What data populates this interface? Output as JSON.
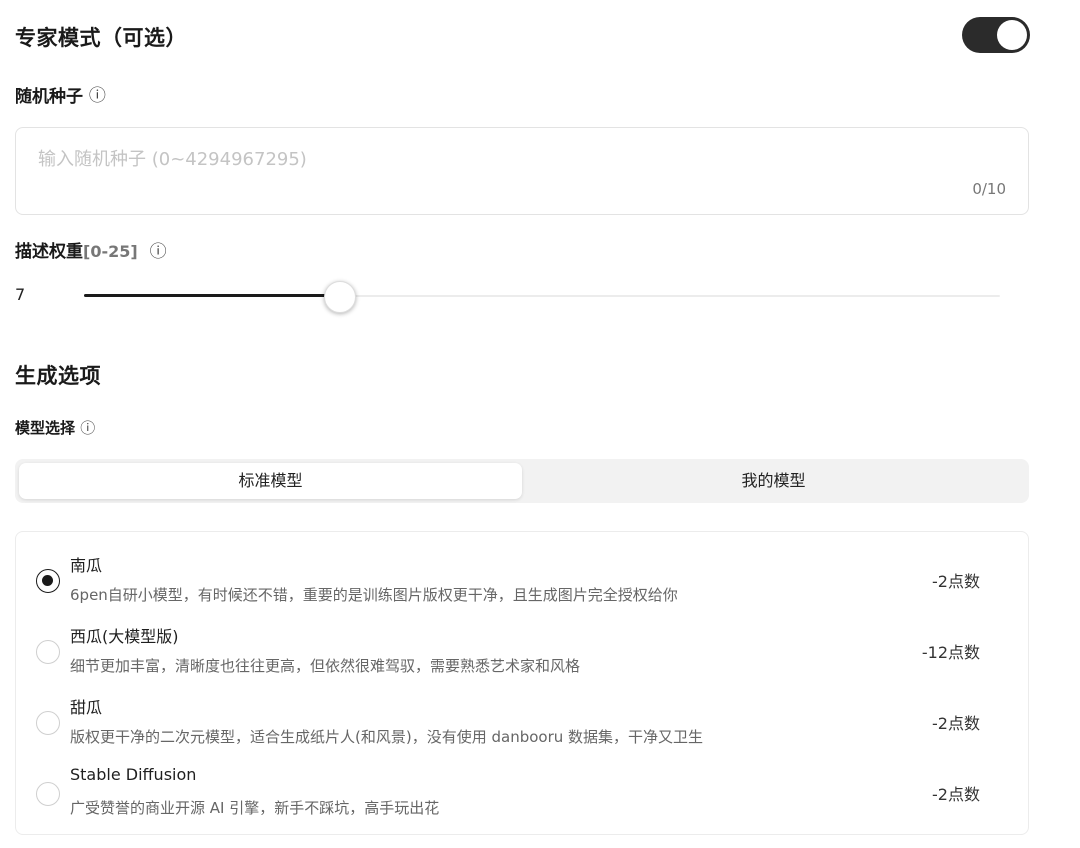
{
  "expert_mode": {
    "title": "专家模式（可选）",
    "enabled": true
  },
  "seed": {
    "label": "随机种子",
    "info_icon": "ⓘ",
    "placeholder": "输入随机种子 (0~4294967295)",
    "value": "",
    "counter": "0/10"
  },
  "weight": {
    "label": "描述权重",
    "range_label": "[0-25]",
    "info_icon": "ⓘ",
    "value": "7",
    "fraction": 0.28
  },
  "generate": {
    "title": "生成选项"
  },
  "model_select": {
    "label": "模型选择",
    "info_icon": "ⓘ",
    "tabs": [
      {
        "label": "标准模型",
        "active": true
      },
      {
        "label": "我的模型",
        "active": false
      }
    ]
  },
  "models": [
    {
      "name": "南瓜",
      "desc": "6pen自研小模型，有时候还不错，重要的是训练图片版权更干净，且生成图片完全授权给你",
      "cost": "-2点数",
      "selected": true
    },
    {
      "name": "西瓜(大模型版)",
      "desc": "细节更加丰富，清晰度也往往更高，但依然很难驾驭，需要熟悉艺术家和风格",
      "cost": "-12点数",
      "selected": false
    },
    {
      "name": "甜瓜",
      "desc": "版权更干净的二次元模型，适合生成纸片人(和风景)，没有使用 danbooru 数据集，干净又卫生",
      "cost": "-2点数",
      "selected": false
    },
    {
      "name": "Stable Diffusion",
      "desc": "广受赞誉的商业开源 AI 引擎，新手不踩坑，高手玩出花",
      "cost": "-2点数",
      "selected": false
    }
  ]
}
